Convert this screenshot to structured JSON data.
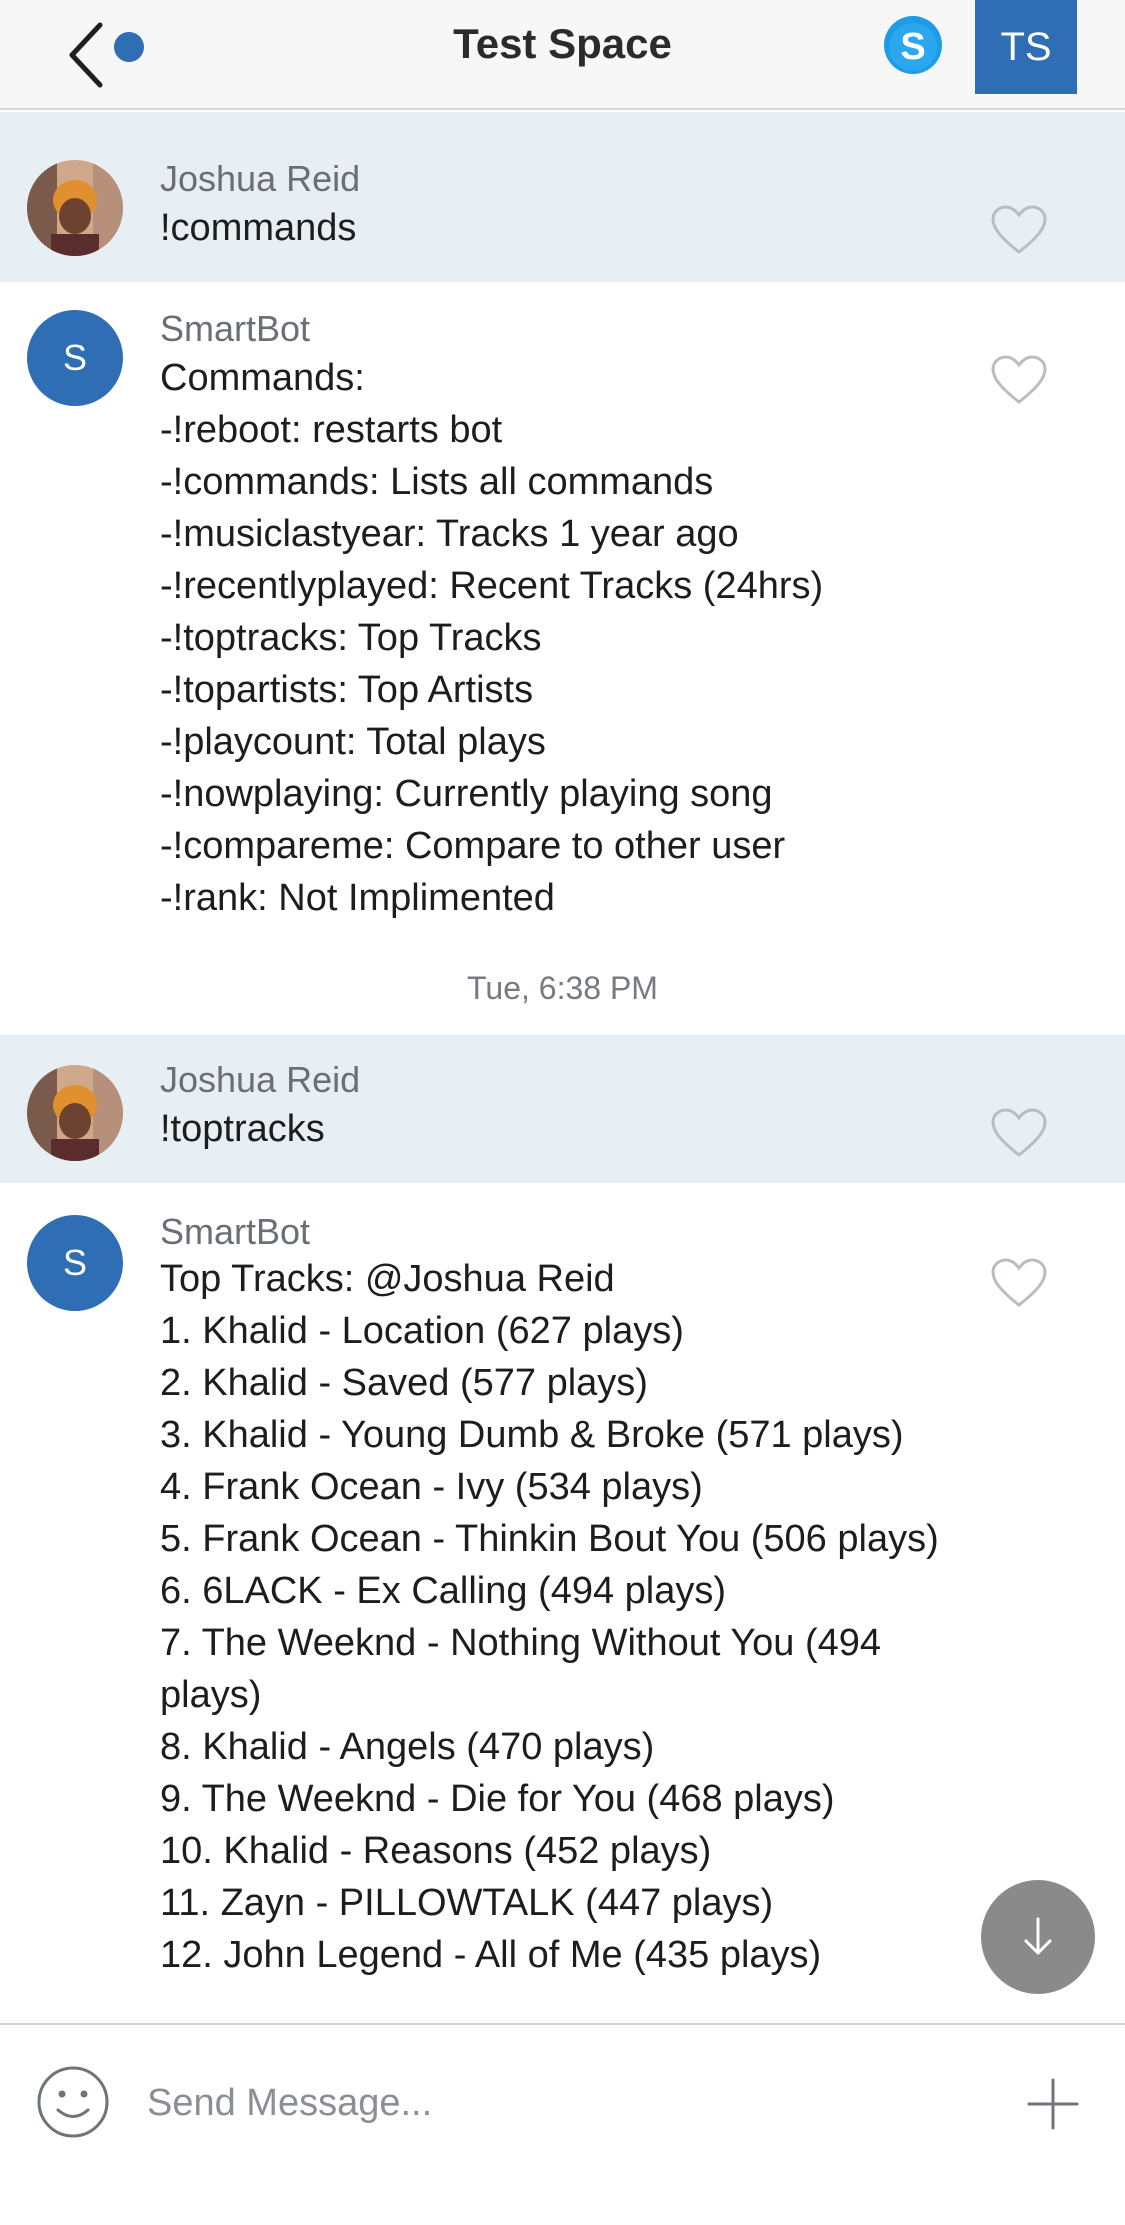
{
  "header": {
    "title": "Test Space",
    "user_initials": "TS",
    "back_icon": "chevron-left-icon",
    "call_icon": "skype-icon"
  },
  "messages": [
    {
      "sender": "Joshua Reid",
      "text": "!commands",
      "type": "user"
    },
    {
      "sender": "SmartBot",
      "avatar_letter": "S",
      "text": "Commands:\n-!reboot: restarts bot\n-!commands: Lists all commands\n-!musiclastyear: Tracks 1 year ago\n-!recentlyplayed: Recent Tracks (24hrs)\n-!toptracks: Top Tracks\n-!topartists: Top Artists\n-!playcount: Total plays\n-!nowplaying: Currently playing song\n-!compareme: Compare to other user\n-!rank: Not Implimented",
      "type": "bot"
    },
    {
      "sender": "Joshua Reid",
      "text": "!toptracks",
      "type": "user"
    },
    {
      "sender": "SmartBot",
      "avatar_letter": "S",
      "text": "Top Tracks: @Joshua Reid\n1. Khalid - Location (627 plays)\n2. Khalid - Saved (577 plays)\n3. Khalid - Young Dumb & Broke (571 plays)\n4. Frank Ocean - Ivy (534 plays)\n5. Frank Ocean - Thinkin Bout You (506 plays)\n6. 6LACK - Ex Calling (494 plays)\n7. The Weeknd - Nothing Without You (494 plays)\n8. Khalid - Angels (470 plays)\n9. The Weeknd - Die for You (468 plays)\n10. Khalid - Reasons (452 plays)\n11. Zayn - PILLOWTALK (447 plays)\n12. John Legend - All of Me (435 plays)",
      "type": "bot"
    }
  ],
  "timestamp": "Tue, 6:38 PM",
  "composer": {
    "placeholder": "Send Message...",
    "emoji_icon": "smiley-icon",
    "add_icon": "plus-icon"
  },
  "colors": {
    "accent": "#2f6db5",
    "user_row_bg": "#e7eef4",
    "scroll_button": "#8a8a8a"
  }
}
